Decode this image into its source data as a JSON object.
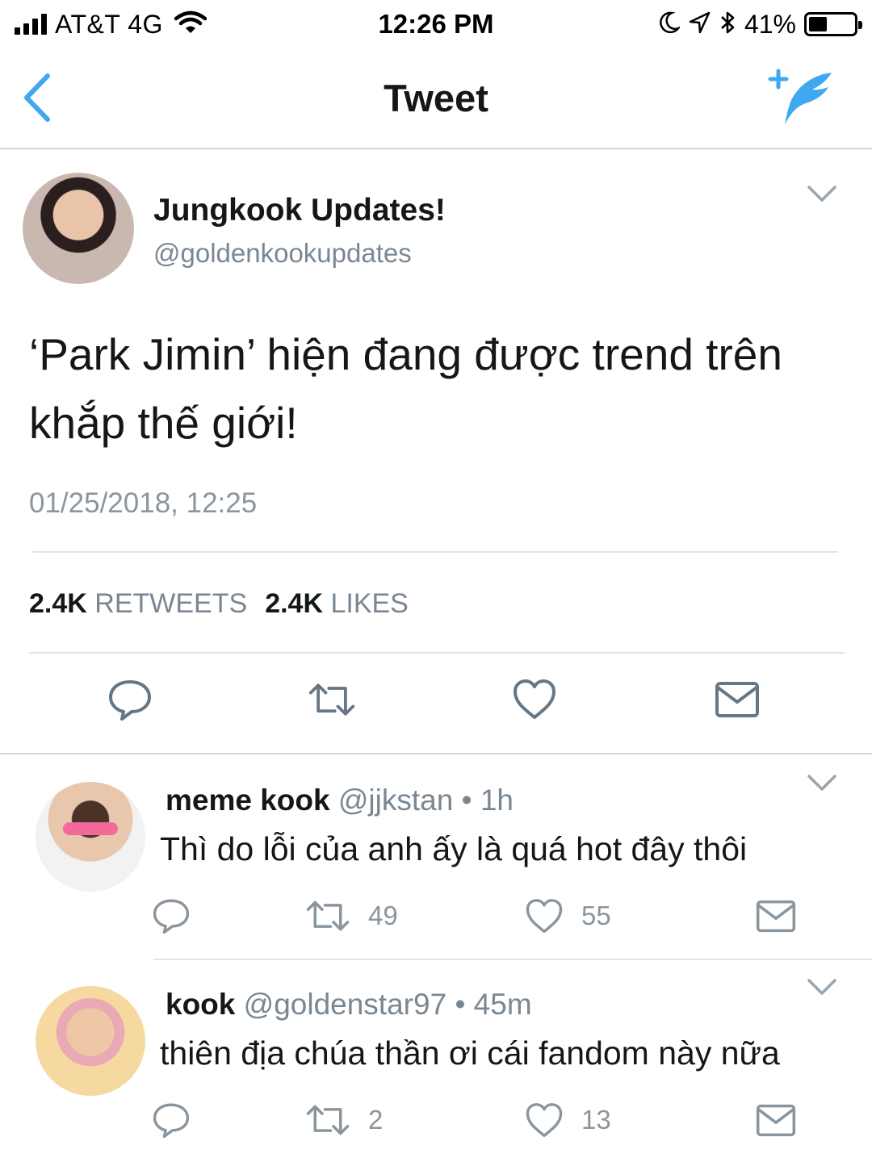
{
  "status_bar": {
    "carrier": "AT&T 4G",
    "time": "12:26 PM",
    "battery_percent": "41%",
    "battery_level": 0.41,
    "icons": [
      "signal-icon",
      "wifi-icon",
      "moon-icon",
      "location-icon",
      "bluetooth-icon",
      "battery-icon"
    ]
  },
  "nav": {
    "title": "Tweet",
    "back_icon": "chevron-left-icon",
    "compose_icon": "compose-tweet-icon"
  },
  "main_tweet": {
    "author_name": "Jungkook Updates!",
    "author_handle": "@goldenkookupdates",
    "text": "‘Park Jimin’ hiện đang được trend trên khắp thế giới!",
    "timestamp": "01/25/2018, 12:25",
    "retweets_count": "2.4K",
    "retweets_label": "RETWEETS",
    "likes_count": "2.4K",
    "likes_label": "LIKES"
  },
  "replies": [
    {
      "name": "meme kook",
      "handle": "@jjkstan",
      "time": "• 1h",
      "text": "Thì do lỗi của anh ấy là quá hot đây thôi",
      "retweets": "49",
      "likes": "55"
    },
    {
      "name": "kook",
      "handle": "@goldenstar97",
      "time": "• 45m",
      "text": "thiên địa chúa thần ơi cái fandom này nữa",
      "retweets": "2",
      "likes": "13"
    }
  ],
  "colors": {
    "accent": "#1da1f2",
    "icon_gray": "#657786",
    "secondary_text": "#7a8792",
    "divider": "#e1e5e8"
  }
}
